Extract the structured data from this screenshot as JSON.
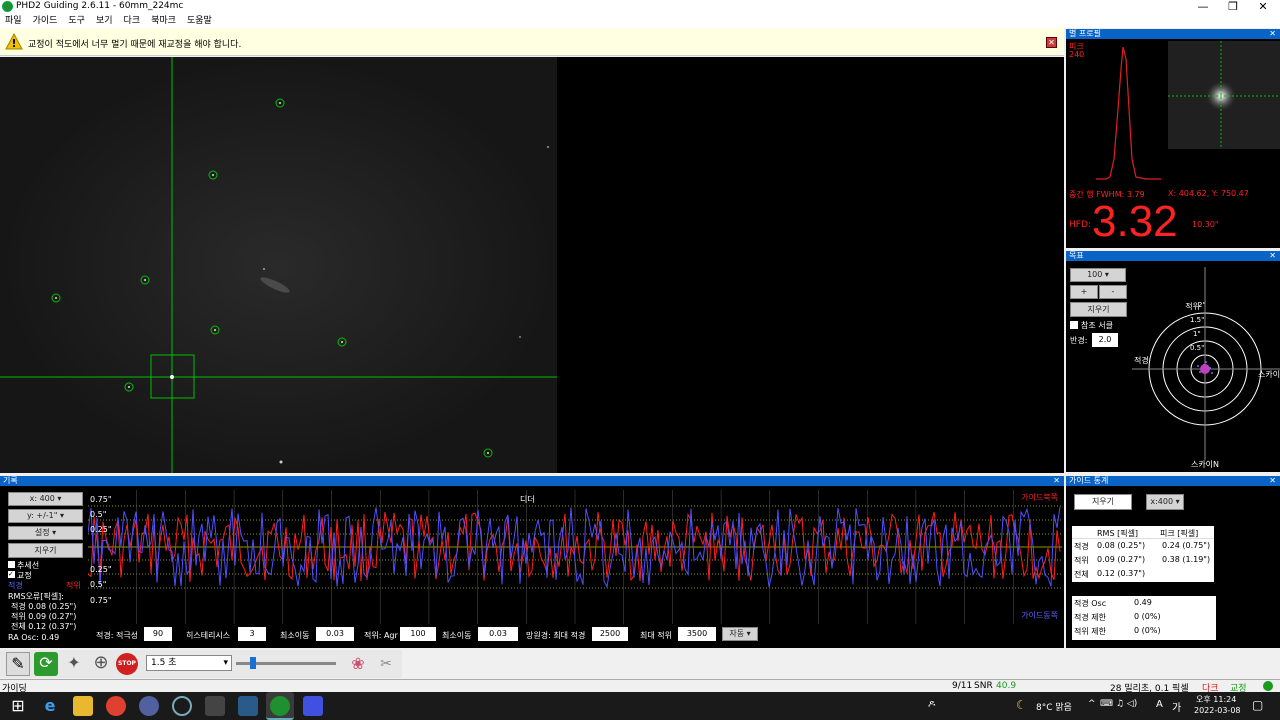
{
  "window": {
    "title": "PHD2 Guiding 2.6.11 - 60mm_224mc"
  },
  "menu": [
    "파일",
    "가이드",
    "도구",
    "보기",
    "다크",
    "북마크",
    "도움말"
  ],
  "alert": {
    "text": "교정이 적도에서 너무 멀기 때문에 재교정을 해야 합니다."
  },
  "star_profile": {
    "title": "별 프로필",
    "peak_label": "피크",
    "peak_value": "240",
    "fwhm": "중간 행 FWHM: 3.79",
    "coords": "X: 404.62, Y: 750.47",
    "hfd_label": "HFD:",
    "hfd_value": "3.32",
    "hfd_arcsec": "10.30\""
  },
  "target": {
    "title": "목표",
    "zoom": "100",
    "plus": "+",
    "minus": "-",
    "clear": "지우기",
    "ref_circle": "참조 서클",
    "radius_label": "반경:",
    "radius_value": "2.0",
    "ring_labels": [
      "2\"",
      "1.5\"",
      "1\"",
      "0.5\""
    ],
    "dec_label": "적위",
    "ra_label": "적경",
    "ra_right": "스카이",
    "bottom_label": "스카이N"
  },
  "history": {
    "title": "기록",
    "x_scale": "x: 400",
    "y_scale": "y: +/-1\"",
    "settings": "설정",
    "clear": "지우기",
    "trendline": "추세선",
    "corrections": "교정",
    "ra_color_label": "적경",
    "dec_color_label": "적위",
    "rms_title": "RMS오류[픽셀]:",
    "rms_ra": "적경 0.08 (0.25\")",
    "rms_dec": "적위 0.09 (0.27\")",
    "rms_total": "전체 0.12 (0.37\")",
    "ra_osc": "RA Osc: 0.49",
    "y_ticks": [
      "0.75\"",
      "0.5\"",
      "0.25\"",
      "0.25\"",
      "0.5\"",
      "0.75\""
    ],
    "dither_label": "디더",
    "top_right_label": "가이드북쪽",
    "bottom_right_label": "가이드동쪽",
    "controls": {
      "ra_label": "적경: 적극성",
      "ra_aggr": "90",
      "hyst_label": "히스테리시스",
      "hyst": "3",
      "min_move_label": "최소이동",
      "min_move": "0.03",
      "dec_label": "적위: Agr",
      "dec_agr": "100",
      "dec_min_label": "최소이동",
      "dec_min": "0.03",
      "scope_label": "망원경: 최대 적경",
      "max_ra": "2500",
      "max_dec_label": "최대 적위",
      "max_dec": "3500",
      "mode": "자동"
    }
  },
  "guide_stats": {
    "title": "가이드 통계",
    "clear": "지우기",
    "scale": "x:400",
    "headers": [
      "",
      "RMS [픽셀]",
      "피크 [픽셀]"
    ],
    "rows": [
      [
        "적경",
        "0.08 (0.25\")",
        "0.24 (0.75\")"
      ],
      [
        "적위",
        "0.09 (0.27\")",
        "0.38 (1.19\")"
      ],
      [
        "전체",
        "0.12 (0.37\")",
        ""
      ]
    ],
    "rows2": [
      [
        "적경 Osc",
        "0.49"
      ],
      [
        "적경 제한",
        "0 (0%)"
      ],
      [
        "적위 제한",
        "0 (0%)"
      ]
    ]
  },
  "toolbar": {
    "exposure": "1.5 초"
  },
  "status": {
    "left": "가이딩",
    "frames": "9/11",
    "snr_label": "SNR",
    "snr": "40.9",
    "info": "28 밀리초, 0.1 픽셀",
    "dark": "다크",
    "cal": "교정"
  },
  "taskbar": {
    "weather": "8°C 맑음",
    "lang": "A",
    "ime": "가",
    "time": "오후 11:24",
    "date": "2022-03-08"
  },
  "colors": {
    "ra": "#ff2020",
    "dec": "#5050ff",
    "title_bar": "#0a64c8",
    "grid": "#c8c800"
  }
}
